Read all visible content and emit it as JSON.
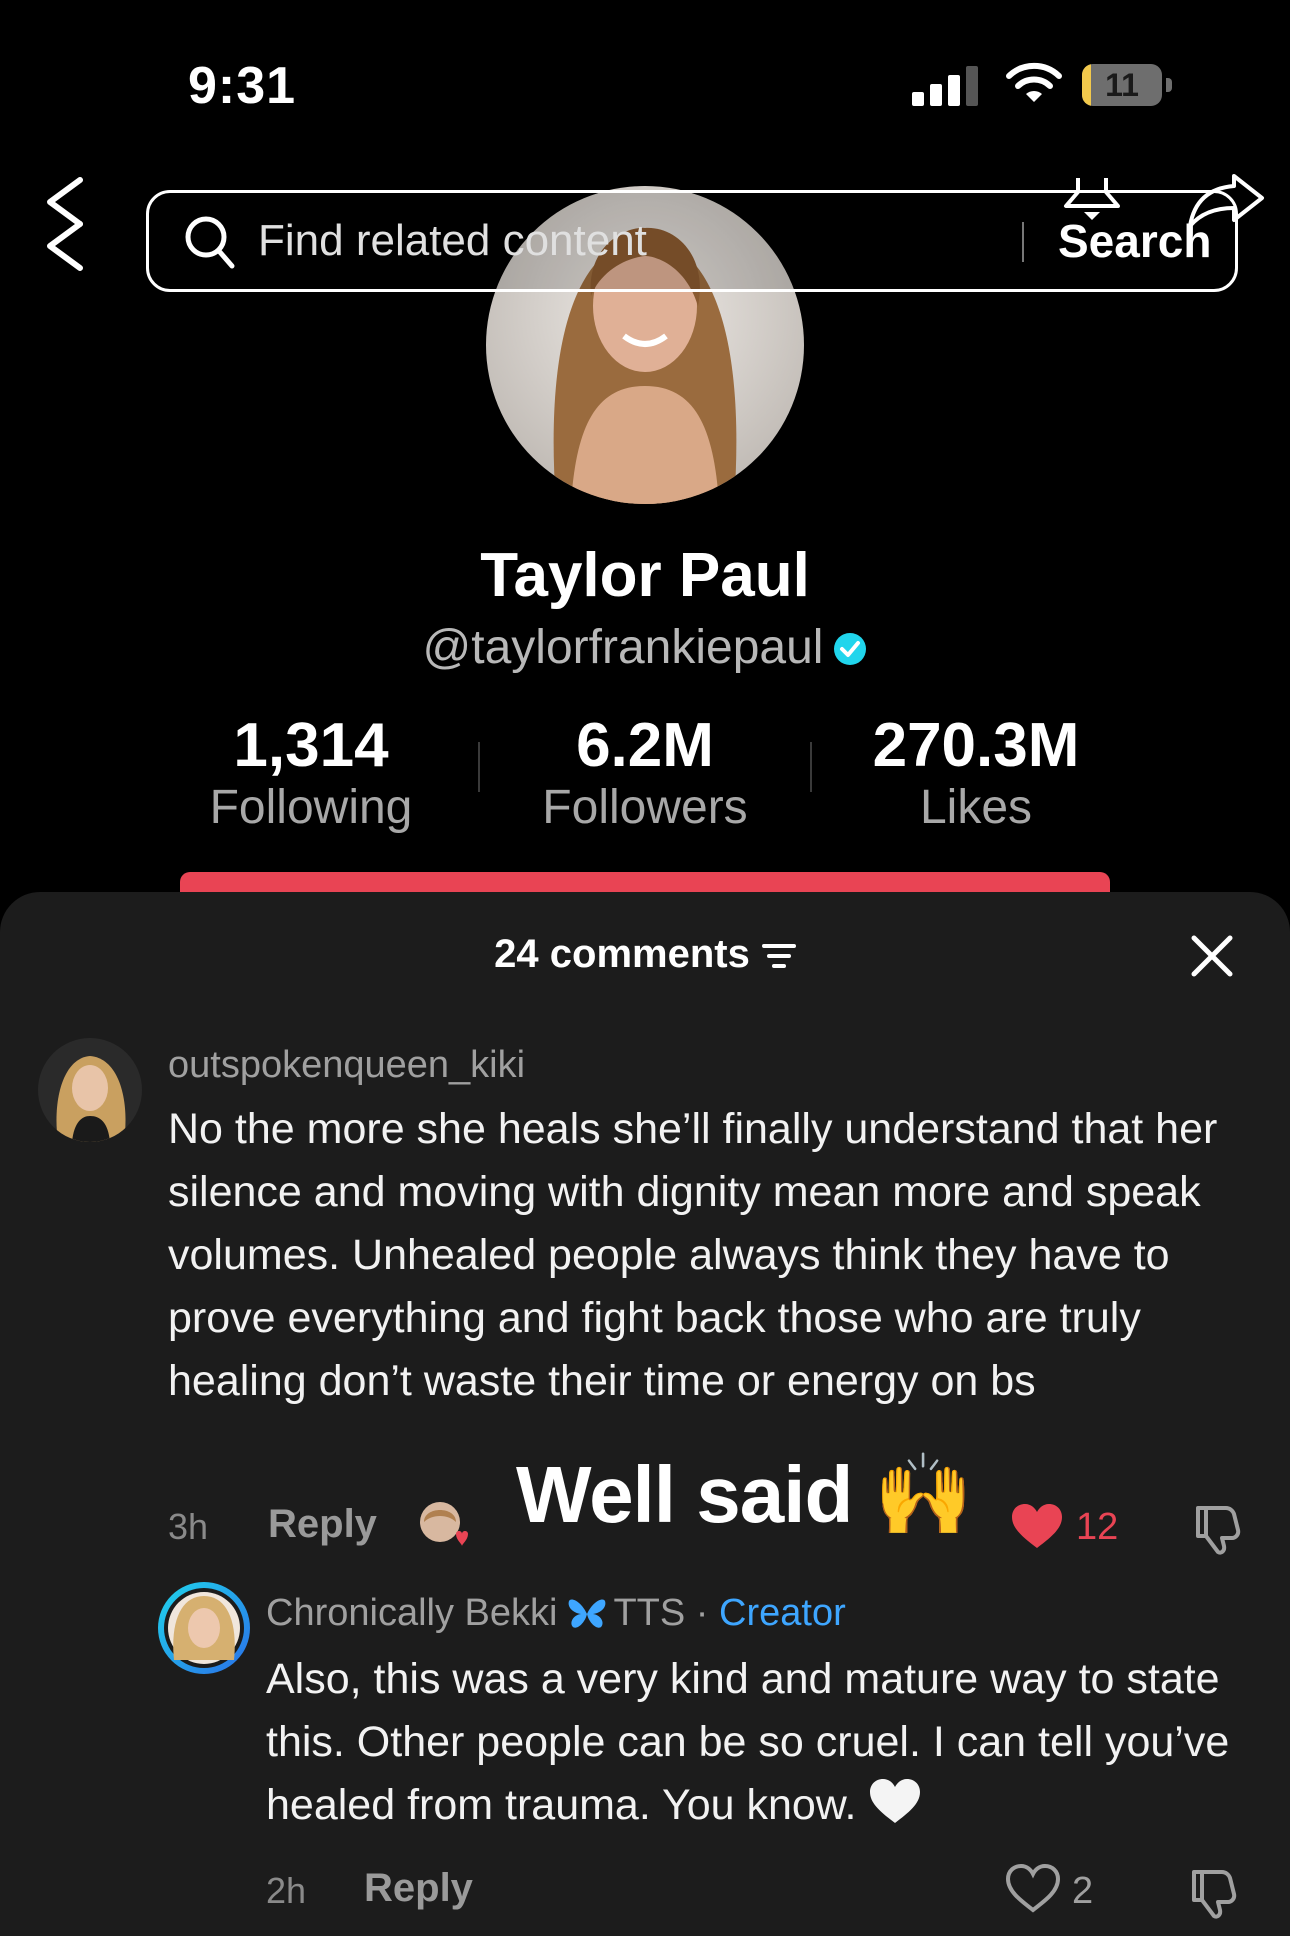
{
  "status_bar": {
    "time": "9:31",
    "battery": "11",
    "battery_level": 0.11
  },
  "search": {
    "placeholder": "Find related content",
    "button_label": "Search"
  },
  "profile": {
    "name": "Taylor Paul",
    "handle": "@taylorfrankiepaul",
    "verified": true,
    "stats": [
      {
        "value": "1,314",
        "label": "Following"
      },
      {
        "value": "6.2M",
        "label": "Followers"
      },
      {
        "value": "270.3M",
        "label": "Likes"
      }
    ]
  },
  "comments": {
    "header": "24 comments",
    "items": [
      {
        "username": "outspokenqueen_kiki",
        "text": "No the more she heals she’ll finally understand that her silence and moving with dignity mean more and speak volumes. Unhealed people always think they have to prove everything and fight back those who are truly healing don’t waste their time or energy on bs",
        "time": "3h",
        "reply_label": "Reply",
        "likes": "12",
        "liked": true
      },
      {
        "username": "Chronically Bekki",
        "source": "TTS",
        "separator": "·",
        "badge": "Creator",
        "text": "Also, this was a very kind and mature way to state this. Other people can be so cruel. I can tell you’ve healed from trauma. You know.",
        "time": "2h",
        "reply_label": "Reply",
        "likes": "2",
        "liked": false
      }
    ]
  },
  "overlay": {
    "caption": "Well said 🙌"
  },
  "colors": {
    "accent": "#e94454",
    "creator": "#3ea6ff",
    "battery": "#f2c94c",
    "sheet": "#1c1c1c"
  },
  "icons": [
    "back-icon",
    "search-icon",
    "bell-icon",
    "share-icon",
    "verified-icon",
    "sort-icon",
    "close-icon",
    "heart-icon",
    "dislike-icon",
    "butterfly-icon"
  ]
}
